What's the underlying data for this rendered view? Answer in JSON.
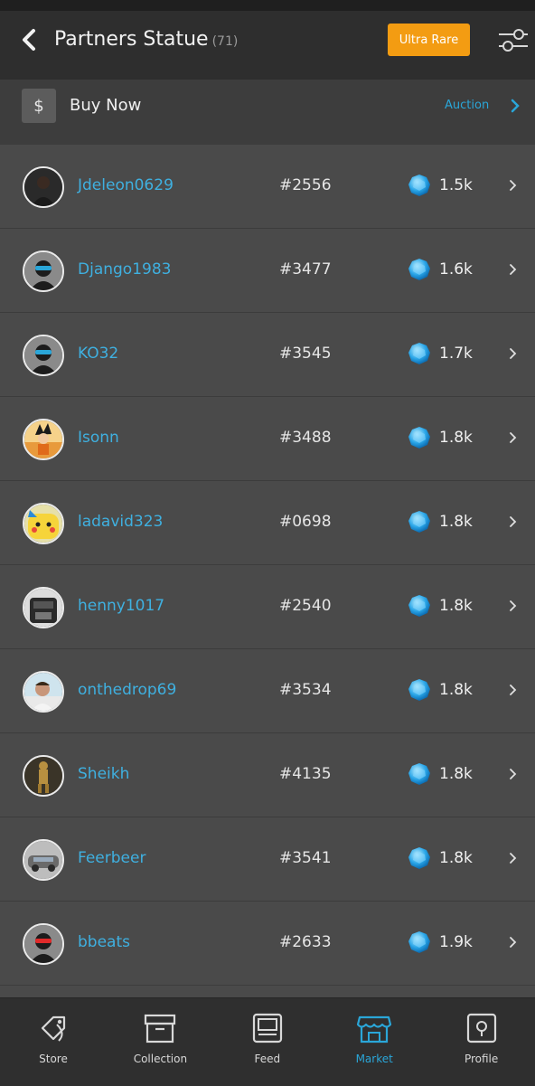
{
  "header": {
    "title": "Partners Statue",
    "count": "(71)",
    "ultra_rare_label": "Ultra Rare"
  },
  "subbar": {
    "currency_symbol": "$",
    "buy_now_label": "Buy Now",
    "auction_label": "Auction"
  },
  "listings": [
    {
      "username": "Jdeleon0629",
      "serial": "#2556",
      "price": "1.5k"
    },
    {
      "username": "Django1983",
      "serial": "#3477",
      "price": "1.6k"
    },
    {
      "username": "KO32",
      "serial": "#3545",
      "price": "1.7k"
    },
    {
      "username": "Isonn",
      "serial": "#3488",
      "price": "1.8k"
    },
    {
      "username": "ladavid323",
      "serial": "#0698",
      "price": "1.8k"
    },
    {
      "username": "henny1017",
      "serial": "#2540",
      "price": "1.8k"
    },
    {
      "username": "onthedrop69",
      "serial": "#3534",
      "price": "1.8k"
    },
    {
      "username": "Sheikh",
      "serial": "#4135",
      "price": "1.8k"
    },
    {
      "username": "Feerbeer",
      "serial": "#3541",
      "price": "1.8k"
    },
    {
      "username": "bbeats",
      "serial": "#2633",
      "price": "1.9k"
    }
  ],
  "tabs": [
    {
      "label": "Store",
      "icon": "tag-icon"
    },
    {
      "label": "Collection",
      "icon": "box-icon"
    },
    {
      "label": "Feed",
      "icon": "feed-icon"
    },
    {
      "label": "Market",
      "icon": "storefront-icon",
      "active": true
    },
    {
      "label": "Profile",
      "icon": "profile-icon"
    }
  ],
  "colors": {
    "accent": "#2aa6d8",
    "ultra_rare": "#f39c12",
    "background": "#4a4a4a",
    "header": "#2e2e2e"
  }
}
